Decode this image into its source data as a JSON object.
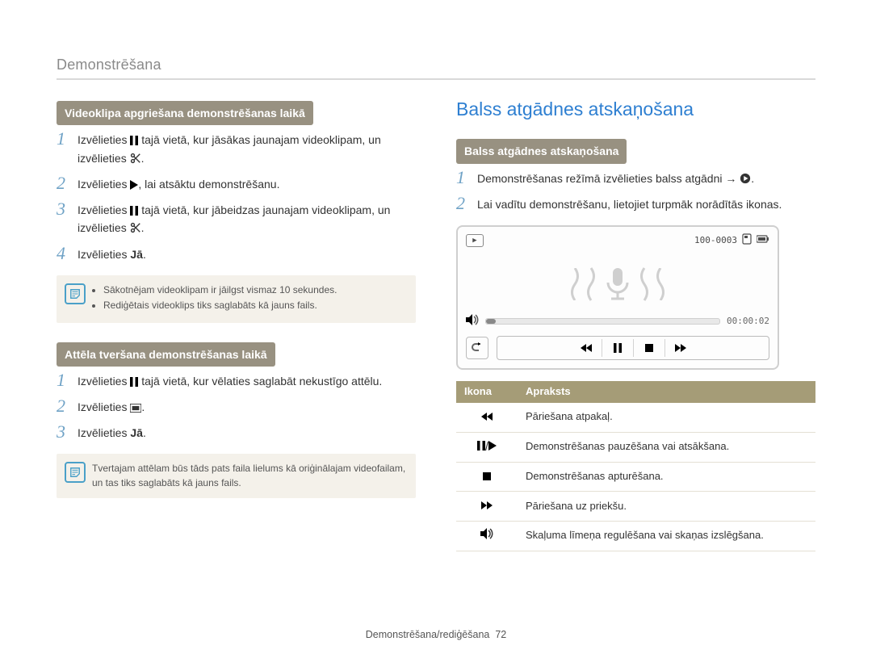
{
  "header": "Demonstrēšana",
  "footer_section": "Demonstrēšana/rediģēšana",
  "footer_page": "72",
  "left": {
    "sec1_title": "Videoklipa apgriešana demonstrēšanas laikā",
    "sec1_steps": [
      {
        "pre": "Izvēlieties ",
        "icon": "pause-icon",
        "mid": " tajā vietā, kur jāsākas jaunajam videoklipam, un izvēlieties ",
        "icon2": "scissors-icon",
        "post": "."
      },
      {
        "pre": "Izvēlieties ",
        "icon": "play-icon",
        "mid": "",
        "icon2": null,
        "post": ", lai atsāktu demonstrēšanu."
      },
      {
        "pre": "Izvēlieties ",
        "icon": "pause-icon",
        "mid": " tajā vietā, kur jābeidzas jaunajam videoklipam, un izvēlieties ",
        "icon2": "scissors-icon",
        "post": "."
      },
      {
        "pre": "Izvēlieties ",
        "icon": null,
        "mid": "",
        "icon2": null,
        "post": "",
        "bold": "Jā",
        "post2": "."
      }
    ],
    "sec1_notes": [
      "Sākotnējam videoklipam ir jāilgst vismaz 10 sekundes.",
      "Rediģētais videoklips tiks saglabāts kā jauns fails."
    ],
    "sec2_title": "Attēla tveršana demonstrēšanas laikā",
    "sec2_steps": [
      {
        "pre": "Izvēlieties ",
        "icon": "pause-icon",
        "mid": " tajā vietā, kur vēlaties saglabāt nekustīgo attēlu.",
        "icon2": null,
        "post": ""
      },
      {
        "pre": "Izvēlieties ",
        "icon": "capture-icon",
        "mid": "",
        "icon2": null,
        "post": "."
      },
      {
        "pre": "Izvēlieties ",
        "icon": null,
        "mid": "",
        "icon2": null,
        "post": "",
        "bold": "Jā",
        "post2": "."
      }
    ],
    "sec2_note": "Tvertajam attēlam būs tāds pats faila lielums kā oriģinālajam videofailam, un tas tiks saglabāts kā jauns fails."
  },
  "right": {
    "section_title": "Balss atgādnes atskaņošana",
    "sec_box_title": "Balss atgādnes atskaņošana",
    "steps": [
      "Demonstrēšanas režīmā izvēlieties balss atgādni → ",
      "Lai vadītu demonstrēšanu, lietojiet turpmāk norādītās ikonas."
    ],
    "step1_icon": "play-circle-icon",
    "player": {
      "counter": "100-0003",
      "time": "00:00:02"
    },
    "table_head": {
      "icon": "Ikona",
      "desc": "Apraksts"
    },
    "table_rows": [
      {
        "icon": "rewind-icon",
        "desc": "Pāriešana atpakaļ."
      },
      {
        "icon": "pause-play-icon",
        "desc": "Demonstrēšanas pauzēšana vai atsākšana."
      },
      {
        "icon": "stop-icon",
        "desc": "Demonstrēšanas apturēšana."
      },
      {
        "icon": "fastforward-icon",
        "desc": "Pāriešana uz priekšu."
      },
      {
        "icon": "volume-icon",
        "desc": "Skaļuma līmeņa regulēšana vai skaņas izslēgšana."
      }
    ]
  }
}
